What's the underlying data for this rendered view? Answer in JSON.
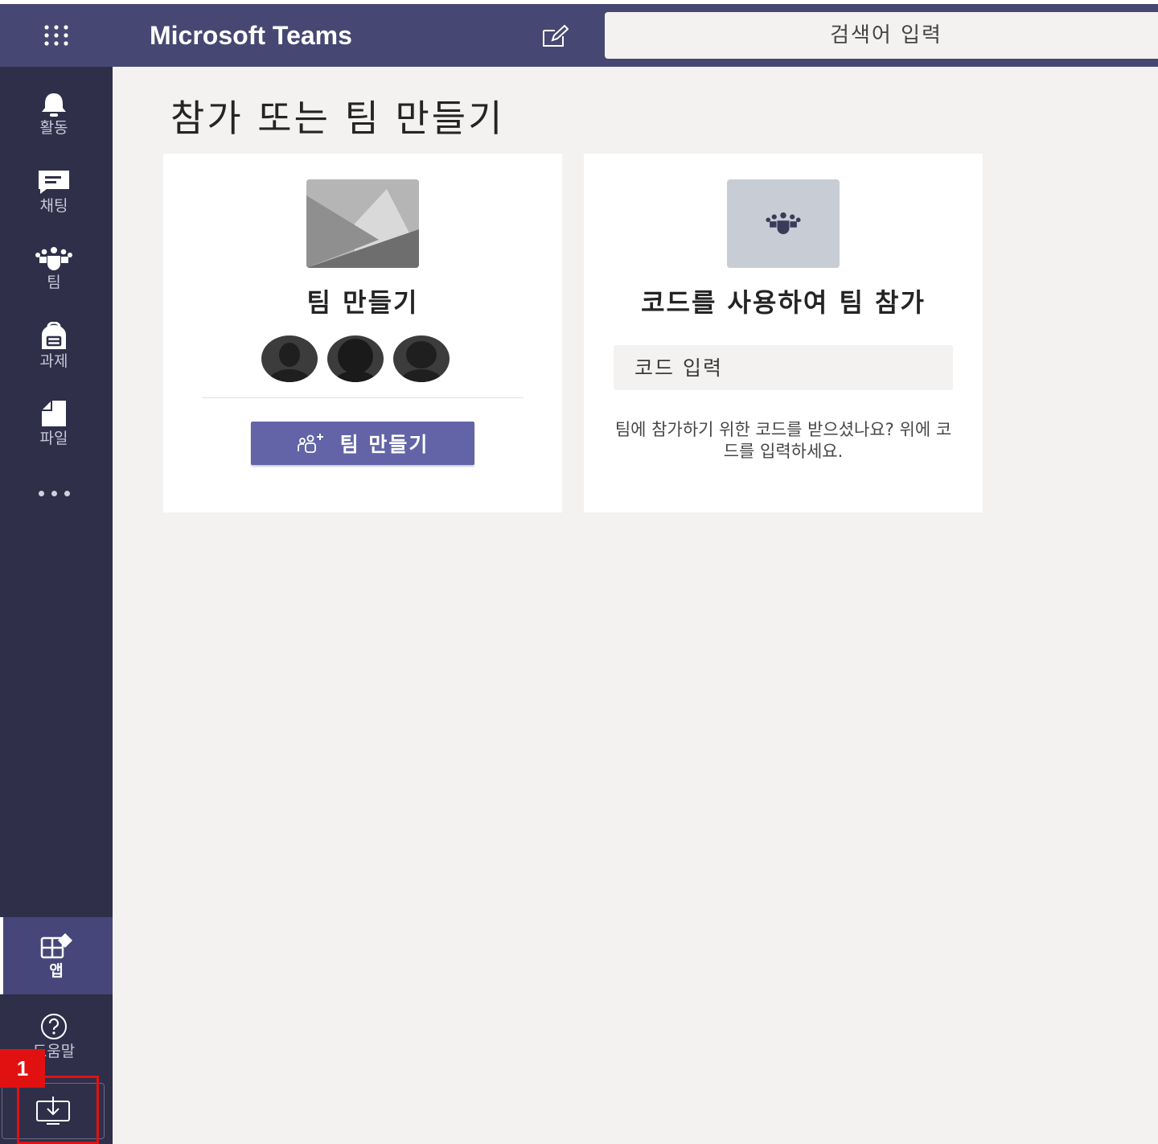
{
  "app": {
    "title": "Microsoft Teams",
    "search_placeholder": "검색어 입력"
  },
  "rail": {
    "items": [
      {
        "label": "활동",
        "icon": "bell-icon"
      },
      {
        "label": "채팅",
        "icon": "chat-icon"
      },
      {
        "label": "팀",
        "icon": "teams-icon"
      },
      {
        "label": "과제",
        "icon": "backpack-icon"
      },
      {
        "label": "파일",
        "icon": "file-icon"
      }
    ],
    "apps_label": "앱",
    "help_label": "도움말",
    "annotation_number": "1"
  },
  "main": {
    "page_title": "참가 또는 팀 만들기",
    "create_card": {
      "heading": "팀 만들기",
      "button_label": "팀 만들기"
    },
    "join_card": {
      "heading": "코드를 사용하여 팀 참가",
      "input_placeholder": "코드 입력",
      "help_text": "팀에 참가하기 위한 코드를 받으셨나요? 위에 코드를 입력하세요."
    }
  },
  "colors": {
    "topbar": "#474773",
    "rail": "#2f2f4a",
    "accent": "#6264a7",
    "annotation": "#e11111"
  }
}
